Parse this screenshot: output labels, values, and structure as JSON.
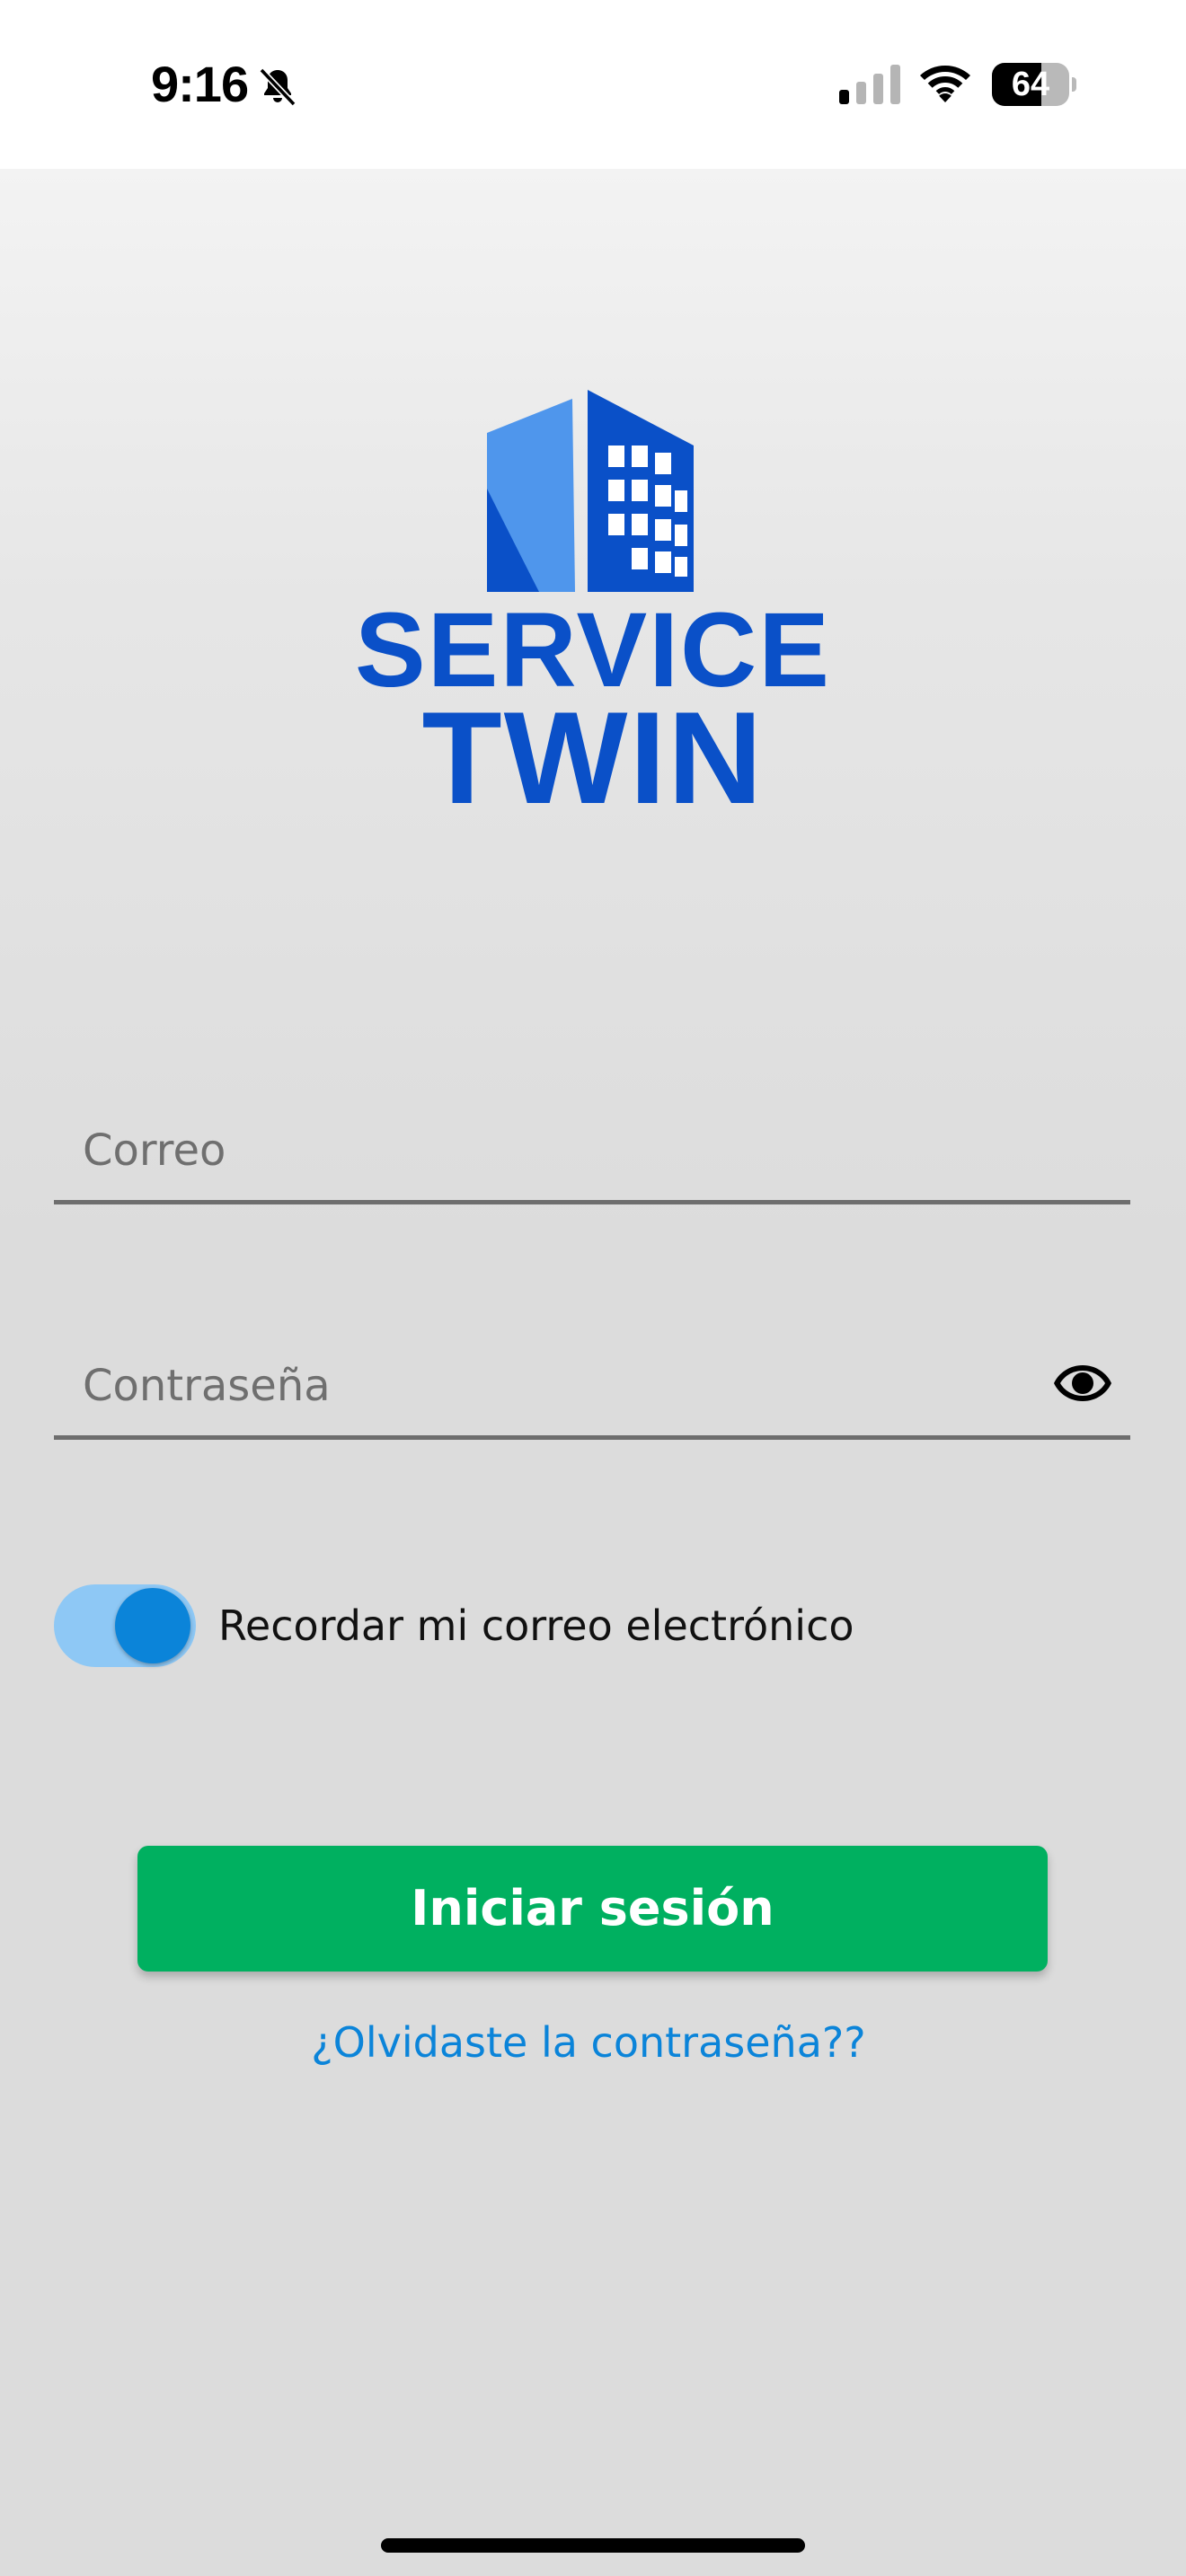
{
  "status_bar": {
    "time": "9:16",
    "battery_level": "64",
    "battery_fraction": 0.64,
    "icons": [
      "bell-slash-icon",
      "cellular-signal-icon",
      "wifi-icon",
      "battery-icon"
    ]
  },
  "logo": {
    "line1": "SERVICE",
    "line2": "TWIN",
    "icon": "building-icon",
    "brand_color": "#0a50c8",
    "accent_color": "#4f96ec"
  },
  "form": {
    "email_placeholder": "Correo",
    "email_value": "",
    "password_placeholder": "Contraseña",
    "password_value": "",
    "show_password_icon": "eye-icon",
    "remember_label": "Recordar mi correo electrónico",
    "remember_checked": true,
    "login_label": "Iniciar sesión",
    "forgot_label": "¿Olvidaste la contraseña??"
  },
  "colors": {
    "primary_button": "#00b060",
    "link": "#0b84d9",
    "toggle_on": "#0b84d9",
    "toggle_track": "#8ec8f5"
  }
}
